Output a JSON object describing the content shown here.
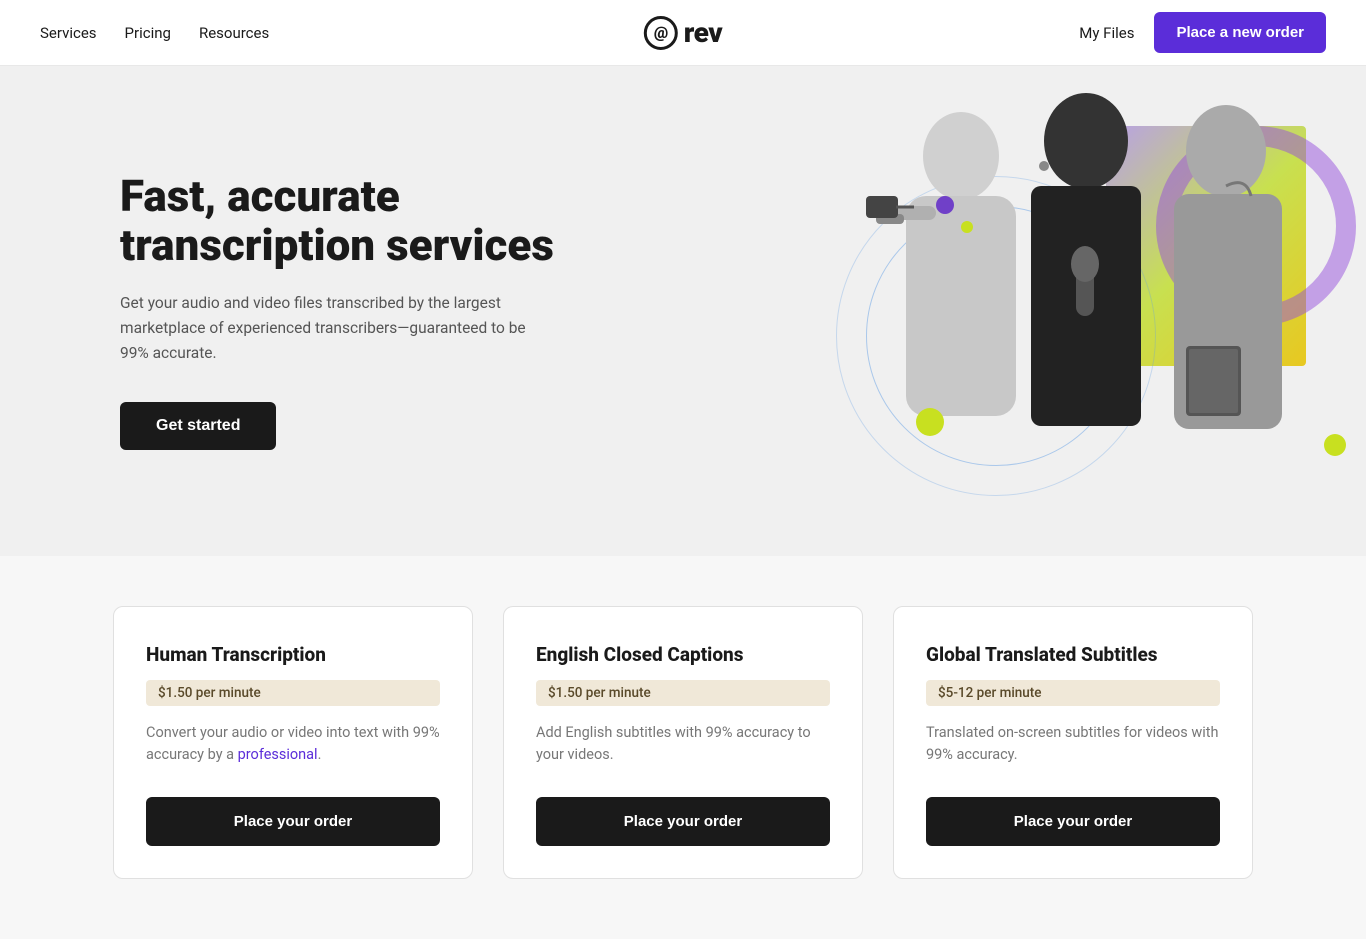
{
  "navbar": {
    "services_label": "Services",
    "pricing_label": "Pricing",
    "resources_label": "Resources",
    "logo_at": "@",
    "logo_text": "rev",
    "my_files_label": "My Files",
    "place_order_label": "Place a new order"
  },
  "hero": {
    "title": "Fast, accurate transcription services",
    "subtitle": "Get your audio and video files transcribed by the largest marketplace of experienced transcribers—guaranteed to be 99% accurate.",
    "cta_label": "Get started"
  },
  "cards": [
    {
      "title": "Human Transcription",
      "price": "$1.50 per minute",
      "description": "Convert your audio or video into text with 99% accuracy by a professional.",
      "cta": "Place your order"
    },
    {
      "title": "English Closed Captions",
      "price": "$1.50 per minute",
      "description": "Add English subtitles with 99% accuracy to your videos.",
      "cta": "Place your order"
    },
    {
      "title": "Global Translated Subtitles",
      "price": "$5-12 per minute",
      "description": "Translated on-screen subtitles for videos with 99% accuracy.",
      "cta": "Place your order"
    }
  ]
}
